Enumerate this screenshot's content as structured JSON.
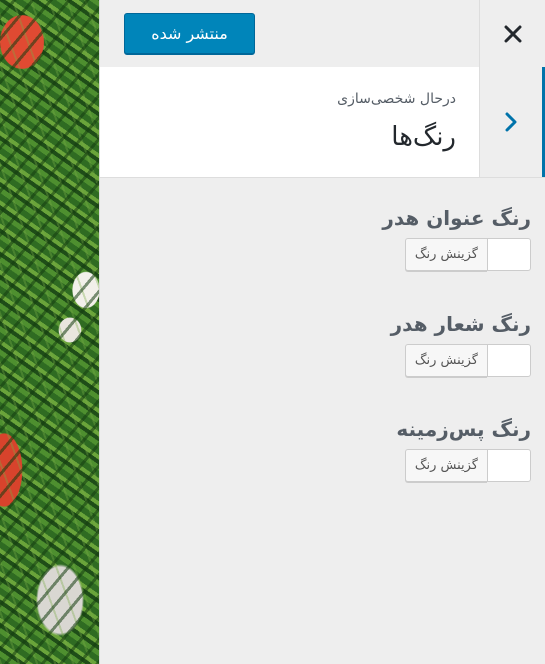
{
  "header": {
    "publish_label": "منتشر شده",
    "close_icon": "close-icon"
  },
  "section": {
    "breadcrumb": "درحال شخصی‌سازی",
    "title": "رنگ‌ها",
    "back_icon": "chevron-right-icon"
  },
  "controls": [
    {
      "label": "رنگ عنوان هدر",
      "button": "گزینش رنگ"
    },
    {
      "label": "رنگ شعار هدر",
      "button": "گزینش رنگ"
    },
    {
      "label": "رنگ پس‌زمینه",
      "button": "گزینش رنگ"
    }
  ],
  "colors": {
    "accent": "#0085ba",
    "accent_dark": "#0073aa",
    "panel_bg": "#eeeeee"
  }
}
